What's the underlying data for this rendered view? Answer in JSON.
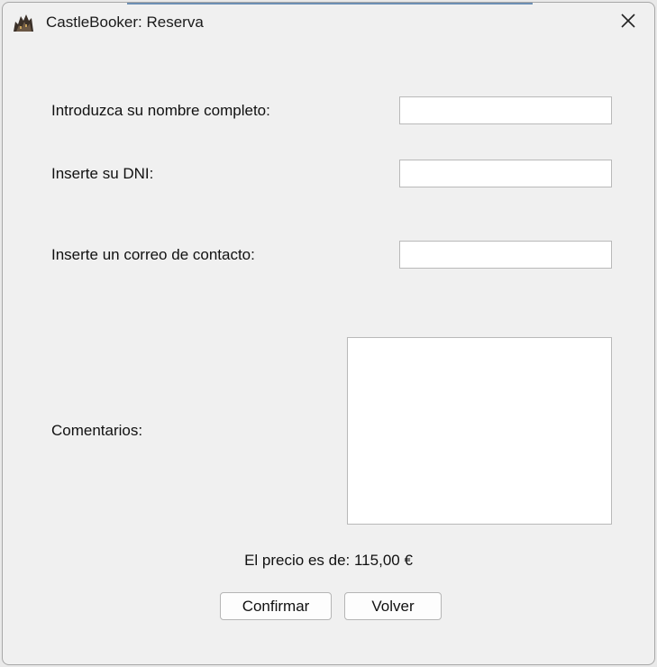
{
  "window": {
    "title": "CastleBooker: Reserva",
    "app_icon": "castle-icon",
    "close_icon": "close-icon"
  },
  "form": {
    "name_label": "Introduzca su nombre completo:",
    "name_value": "",
    "dni_label": "Inserte su DNI:",
    "dni_value": "",
    "email_label": "Inserte un correo de contacto:",
    "email_value": "",
    "comments_label": "Comentarios:",
    "comments_value": ""
  },
  "price_text": "El precio es de: 115,00 €",
  "buttons": {
    "confirm_label": "Confirmar",
    "back_label": "Volver"
  }
}
